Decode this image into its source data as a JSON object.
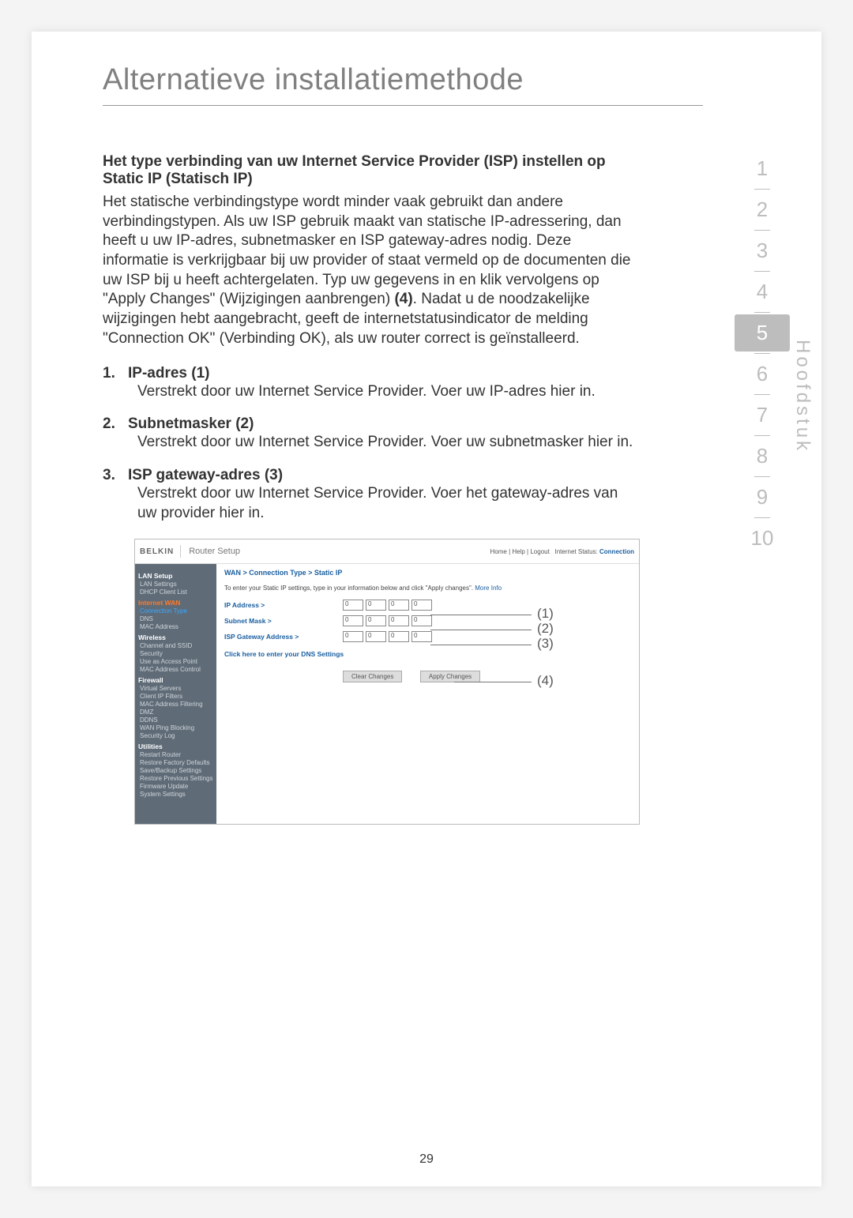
{
  "page": {
    "title": "Alternatieve installatiemethode",
    "number": "29"
  },
  "hoofdstuk_label": "Hoofdstuk",
  "chapters": [
    "1",
    "2",
    "3",
    "4",
    "5",
    "6",
    "7",
    "8",
    "9",
    "10"
  ],
  "active_chapter": "5",
  "section": {
    "heading": "Het type verbinding van uw Internet Service Provider (ISP) instellen op Static IP (Statisch IP)",
    "body_1": "Het statische verbindingstype wordt minder vaak gebruikt dan andere verbindingstypen. Als uw ISP gebruik maakt van statische IP-adressering, dan heeft u uw IP-adres, subnetmasker en ISP gateway-adres nodig. Deze informatie is verkrijgbaar bij uw provider of staat vermeld op de documenten die uw ISP bij u heeft achtergelaten. Typ uw gegevens in en klik vervolgens op \"Apply Changes\" (Wijzigingen aanbrengen) ",
    "body_bold": "(4)",
    "body_2": ". Nadat u de noodzakelijke wijzigingen hebt aangebracht, geeft de internetstatusindicator de melding \"Connection OK\" (Verbinding OK), als uw router correct is geïnstalleerd."
  },
  "items": [
    {
      "num": "1.",
      "label": "IP-adres (1)",
      "text": "Verstrekt door uw Internet Service Provider. Voer uw IP-adres hier in."
    },
    {
      "num": "2.",
      "label": "Subnetmasker (2)",
      "text": "Verstrekt door uw Internet Service Provider. Voer uw subnetmasker hier in."
    },
    {
      "num": "3.",
      "label": "ISP gateway-adres (3)",
      "text": "Verstrekt door uw Internet Service Provider. Voer het gateway-adres van uw provider hier in."
    }
  ],
  "screenshot": {
    "brand": "BELKIN",
    "router_setup": "Router Setup",
    "top_links": "Home | Help | Logout",
    "status_label": "Internet Status:",
    "status_value": "Connection",
    "breadcrumb": "WAN > Connection Type > Static IP",
    "instruction": "To enter your Static IP settings, type in your information below and click \"Apply changes\".",
    "more_info": "More Info",
    "fields": {
      "ip": "IP Address >",
      "subnet": "Subnet Mask >",
      "gateway": "ISP Gateway Address >"
    },
    "octet": "0",
    "dns_link": "Click here to enter your DNS Settings",
    "clear": "Clear Changes",
    "apply": "Apply Changes",
    "side": {
      "lan_setup": "LAN Setup",
      "lan_settings": "LAN Settings",
      "dhcp": "DHCP Client List",
      "internet_wan": "Internet WAN",
      "conn_type": "Connection Type",
      "dns": "DNS",
      "mac": "MAC Address",
      "wireless": "Wireless",
      "ch_ssid": "Channel and SSID",
      "security": "Security",
      "use_ap": "Use as Access Point",
      "mac_ctrl": "MAC Address Control",
      "firewall": "Firewall",
      "vservers": "Virtual Servers",
      "cfilters": "Client IP Filters",
      "mac_filter": "MAC Address Filtering",
      "dmz": "DMZ",
      "ddns": "DDNS",
      "wan_ping": "WAN Ping Blocking",
      "seclog": "Security Log",
      "utilities": "Utilities",
      "restart": "Restart Router",
      "restore_fd": "Restore Factory Defaults",
      "save_backup": "Save/Backup Settings",
      "restore_prev": "Restore Previous Settings",
      "fw_update": "Firmware Update",
      "sys_settings": "System Settings"
    }
  },
  "callouts": {
    "c1": "(1)",
    "c2": "(2)",
    "c3": "(3)",
    "c4": "(4)"
  }
}
